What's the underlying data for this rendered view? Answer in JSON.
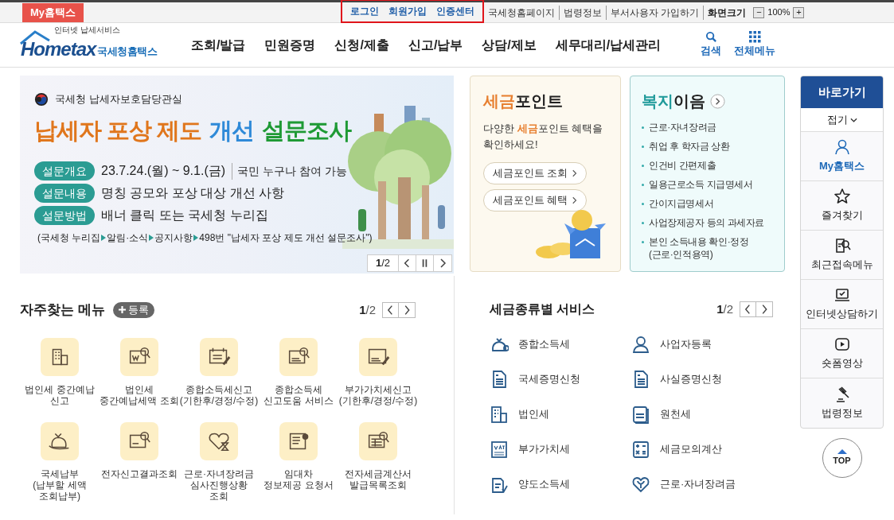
{
  "top_bar": {
    "my_tag": "My홈택스",
    "account_links": [
      "로그인",
      "회원가입",
      "인증센터"
    ],
    "links": [
      "국세청홈페이지",
      "법령정보",
      "부서사용자 가입하기"
    ],
    "zoom": {
      "label": "화면크기",
      "minus": "−",
      "value": "100%",
      "plus": "+"
    }
  },
  "header": {
    "logo": {
      "tagline": "인터넷 납세서비스",
      "word": "Hometax",
      "name": "국세청홈택스"
    },
    "nav": [
      "조회/발급",
      "민원증명",
      "신청/제출",
      "신고/납부",
      "상담/제보",
      "세무대리/납세관리"
    ],
    "tools": [
      "검색",
      "전체메뉴"
    ]
  },
  "banner": {
    "org": "국세청 납세자보호담당관실",
    "title": [
      {
        "text": "납세자 포상 제도",
        "color": "#e0761c"
      },
      {
        "text": "개선",
        "color": "#2f8ad8"
      },
      {
        "text": "설문조사",
        "color": "#1f9a35"
      }
    ],
    "rows": [
      {
        "tag": "설문개요",
        "text": "23.7.24.(월) ~ 9.1.(금)",
        "extra": "국민 누구나 참여 가능"
      },
      {
        "tag": "설문내용",
        "text": "명칭 공모와 포상 대상 개선 사항"
      },
      {
        "tag": "설문방법",
        "text": "배너 클릭 또는 국세청 누리집"
      }
    ],
    "path": [
      "(국세청 누리집",
      "알림·소식",
      "공지사항",
      "498번 \"납세자 포상 제도 개선 설문조사\")"
    ],
    "pager": {
      "current": "1",
      "total": "/2"
    }
  },
  "tax_point": {
    "title": [
      {
        "text": "세금",
        "highlight": true
      },
      {
        "text": "포인트",
        "highlight": false
      }
    ],
    "desc": [
      {
        "text": "다양한 ",
        "highlight": false
      },
      {
        "text": "세금",
        "highlight": true
      },
      {
        "text": "포인트 혜택을 확인하세요!",
        "highlight": false
      }
    ],
    "buttons": [
      "세금포인트 조회",
      "세금포인트 혜택"
    ]
  },
  "welfare": {
    "title": [
      {
        "text": "복지",
        "highlight": true
      },
      {
        "text": "이음",
        "highlight": false
      }
    ],
    "items": [
      "근로·자녀장려금",
      "취업 후 학자금 상환",
      "인건비 간편제출",
      "일용근로소득 지급명세서",
      "간이지급명세서",
      "사업장제공자 등의 과세자료",
      "본인 소득내용 확인·정정\n(근로·인적용역)"
    ]
  },
  "quick_menu": {
    "title": "바로가기",
    "fold": "접기",
    "items": [
      {
        "label": "My홈택스",
        "selected": true
      },
      {
        "label": "즐겨찾기",
        "selected": false
      },
      {
        "label": "최근접속메뉴",
        "selected": false
      },
      {
        "label": "인터넷상담하기",
        "selected": false
      },
      {
        "label": "숏폼영상",
        "selected": false
      },
      {
        "label": "법령정보",
        "selected": false
      }
    ],
    "top": "TOP"
  },
  "frequent_menu": {
    "title": "자주찾는 메뉴",
    "add": "등록",
    "pager": {
      "current": "1",
      "total": "/2"
    },
    "items": [
      "법인세 중간예납\n신고",
      "법인세\n중간예납세액 조회",
      "종합소득세신고\n(기한후/경정/수정)",
      "종합소득세\n신고도움 서비스",
      "부가가치세신고\n(기한후/경정/수정)",
      "국세납부\n(납부할 세액\n조회납부)",
      "전자신고결과조회",
      "근로·자녀장려금\n심사진행상황\n조회",
      "임대차\n정보제공 요청서",
      "전자세금계산서\n발급목록조회"
    ]
  },
  "tax_services": {
    "title": "세금종류별 서비스",
    "pager": {
      "current": "1",
      "total": "/2"
    },
    "items": [
      "종합소득세",
      "사업자등록",
      "국세증명신청",
      "사실증명신청",
      "법인세",
      "원천세",
      "부가가치세",
      "세금모의계산",
      "양도소득세",
      "근로·자녀장려금"
    ]
  }
}
